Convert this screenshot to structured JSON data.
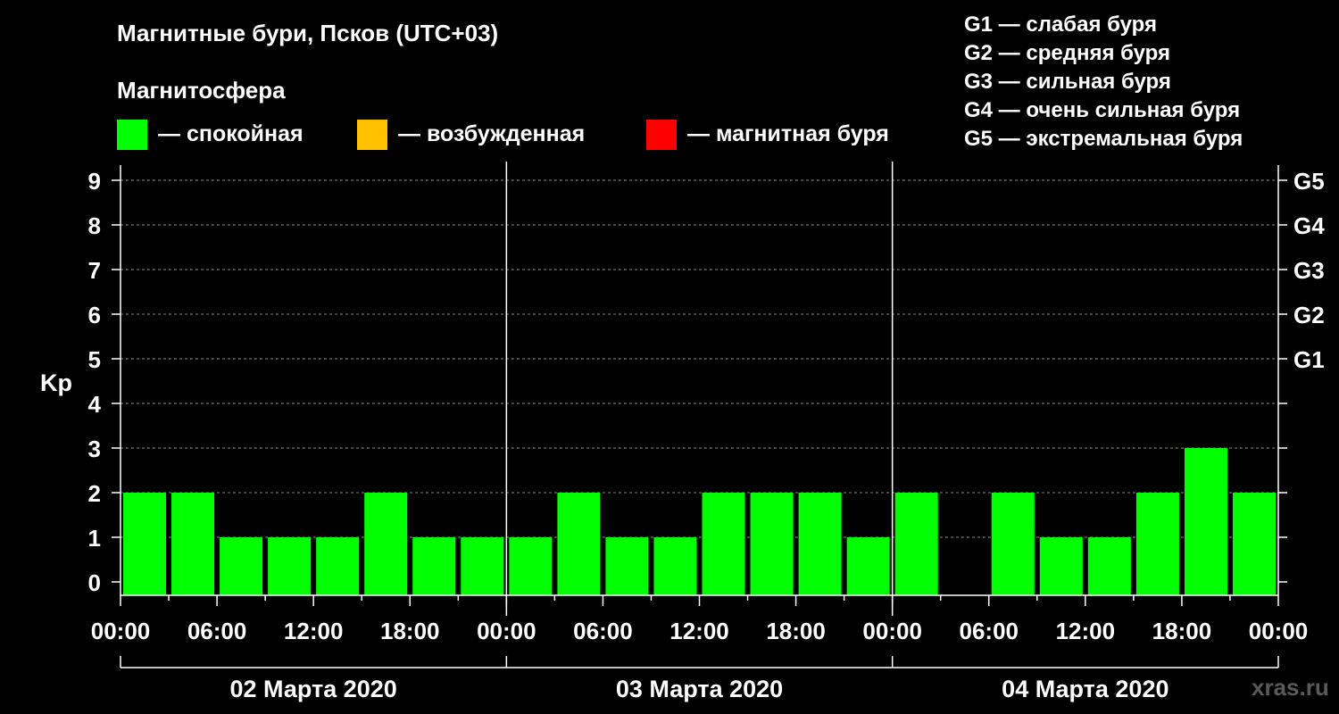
{
  "title": "Магнитные бури, Псков (UTC+03)",
  "subtitle": "Магнитосфера",
  "legend": [
    {
      "label": "— спокойная",
      "color": "#00ff00"
    },
    {
      "label": "— возбужденная",
      "color": "#ffc000"
    },
    {
      "label": "— магнитная буря",
      "color": "#ff0000"
    }
  ],
  "g_legend": [
    "G1 — слабая буря",
    "G2 — средняя буря",
    "G3 — сильная буря",
    "G4 — очень сильная буря",
    "G5 — экстремальная буря"
  ],
  "watermark": "xras.ru",
  "chart_data": {
    "type": "bar",
    "ylabel": "Kp",
    "ylim": [
      0,
      9
    ],
    "y_ticks": [
      "0",
      "1",
      "2",
      "3",
      "4",
      "5",
      "6",
      "7",
      "8",
      "9"
    ],
    "right_ticks": [
      {
        "kp": 5,
        "label": "G1"
      },
      {
        "kp": 6,
        "label": "G2"
      },
      {
        "kp": 7,
        "label": "G3"
      },
      {
        "kp": 8,
        "label": "G4"
      },
      {
        "kp": 9,
        "label": "G5"
      }
    ],
    "x_tick_labels": [
      "00:00",
      "06:00",
      "12:00",
      "18:00",
      "00:00",
      "06:00",
      "12:00",
      "18:00",
      "00:00",
      "06:00",
      "12:00",
      "18:00",
      "00:00"
    ],
    "days": [
      "02 Марта 2020",
      "03 Марта 2020",
      "04 Марта 2020"
    ],
    "interval_hours": 3,
    "values": [
      2,
      2,
      1,
      1,
      1,
      2,
      1,
      1,
      1,
      2,
      1,
      1,
      2,
      2,
      2,
      1,
      2,
      0,
      2,
      1,
      1,
      2,
      3,
      2
    ],
    "bar_color": "#00ff00",
    "grid": true
  }
}
